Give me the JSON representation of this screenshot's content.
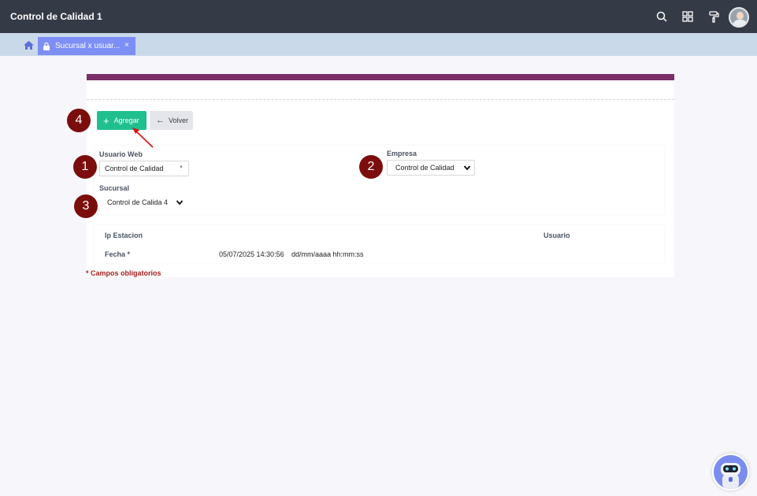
{
  "header": {
    "title": "Control de Calidad 1"
  },
  "icons": {
    "search": "search-icon",
    "apps": "grid-icon",
    "theme": "paint-roller-icon",
    "avatar": "user-avatar"
  },
  "tabs": [
    {
      "label": "Sucursal x usuar...",
      "close": "×"
    }
  ],
  "toolbar": {
    "add_label": "Agregar",
    "back_label": "Volver"
  },
  "form": {
    "usuario_web": {
      "label": "Usuario Web",
      "value": "Control de Calidad"
    },
    "empresa": {
      "label": "Empresa",
      "value": "Control de Calidad"
    },
    "sucursal": {
      "label": "Sucursal",
      "value": "Control de Calida 4"
    }
  },
  "details": {
    "ip_label": "Ip Estacion",
    "usuario_label": "Usuario",
    "fecha_label": "Fecha *",
    "fecha_value": "05/07/2025 14:30:56",
    "fecha_format": "dd/mm/aaaa hh:mm:ss"
  },
  "required_note": "* Campos obligatorios",
  "annotations": {
    "b1": "1",
    "b2": "2",
    "b3": "3",
    "b4": "4"
  },
  "colors": {
    "accent_bar": "#7a2e6a",
    "add_button": "#1fc08e",
    "tab": "#7d8ef4",
    "badge": "#7b0d0d"
  }
}
